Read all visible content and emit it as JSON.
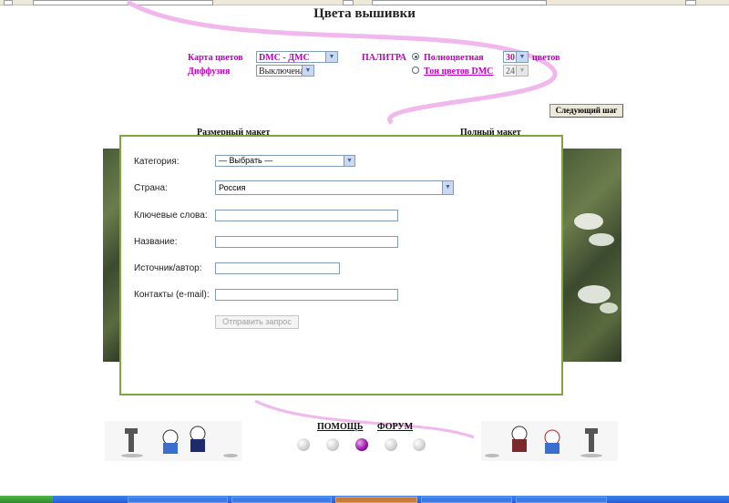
{
  "page_title": "Цвета вышивки",
  "settings": {
    "color_map_label": "Карта цветов",
    "color_map_value": "DMC - ДМС",
    "diffusion_label": "Диффузия",
    "diffusion_value": "Выключена",
    "palette_label": "ПАЛИТРА",
    "palette_options": [
      {
        "label": "Полноцветная",
        "selected": true
      },
      {
        "label": "Тон цветов DMC",
        "selected": false
      }
    ],
    "full_color_count": "30",
    "full_color_unit": "цветов",
    "dmc_tone_count": "24",
    "next_step_label": "Следующий шаг"
  },
  "columns": {
    "left": "Размерный макет",
    "right": "Полный макет"
  },
  "form": {
    "category_label": "Категория:",
    "category_value": "— Выбрать —",
    "country_label": "Страна:",
    "country_value": "Россия",
    "keywords_label": "Ключевые слова:",
    "keywords_value": "",
    "name_label": "Название:",
    "name_value": "",
    "source_label": "Источник/автор:",
    "source_value": "",
    "contacts_label": "Контакты (e-mail):",
    "contacts_value": "",
    "submit_label": "Отправить запрос"
  },
  "footer": {
    "help_link": "ПОМОЩЬ",
    "forum_link": "ФОРУМ",
    "steps": [
      {
        "active": false
      },
      {
        "active": false
      },
      {
        "active": true
      },
      {
        "active": false
      },
      {
        "active": false
      }
    ]
  },
  "colors": {
    "accent_label": "#c000c0",
    "dialog_border": "#7ea63b",
    "active_step": "#9a1aa8"
  }
}
